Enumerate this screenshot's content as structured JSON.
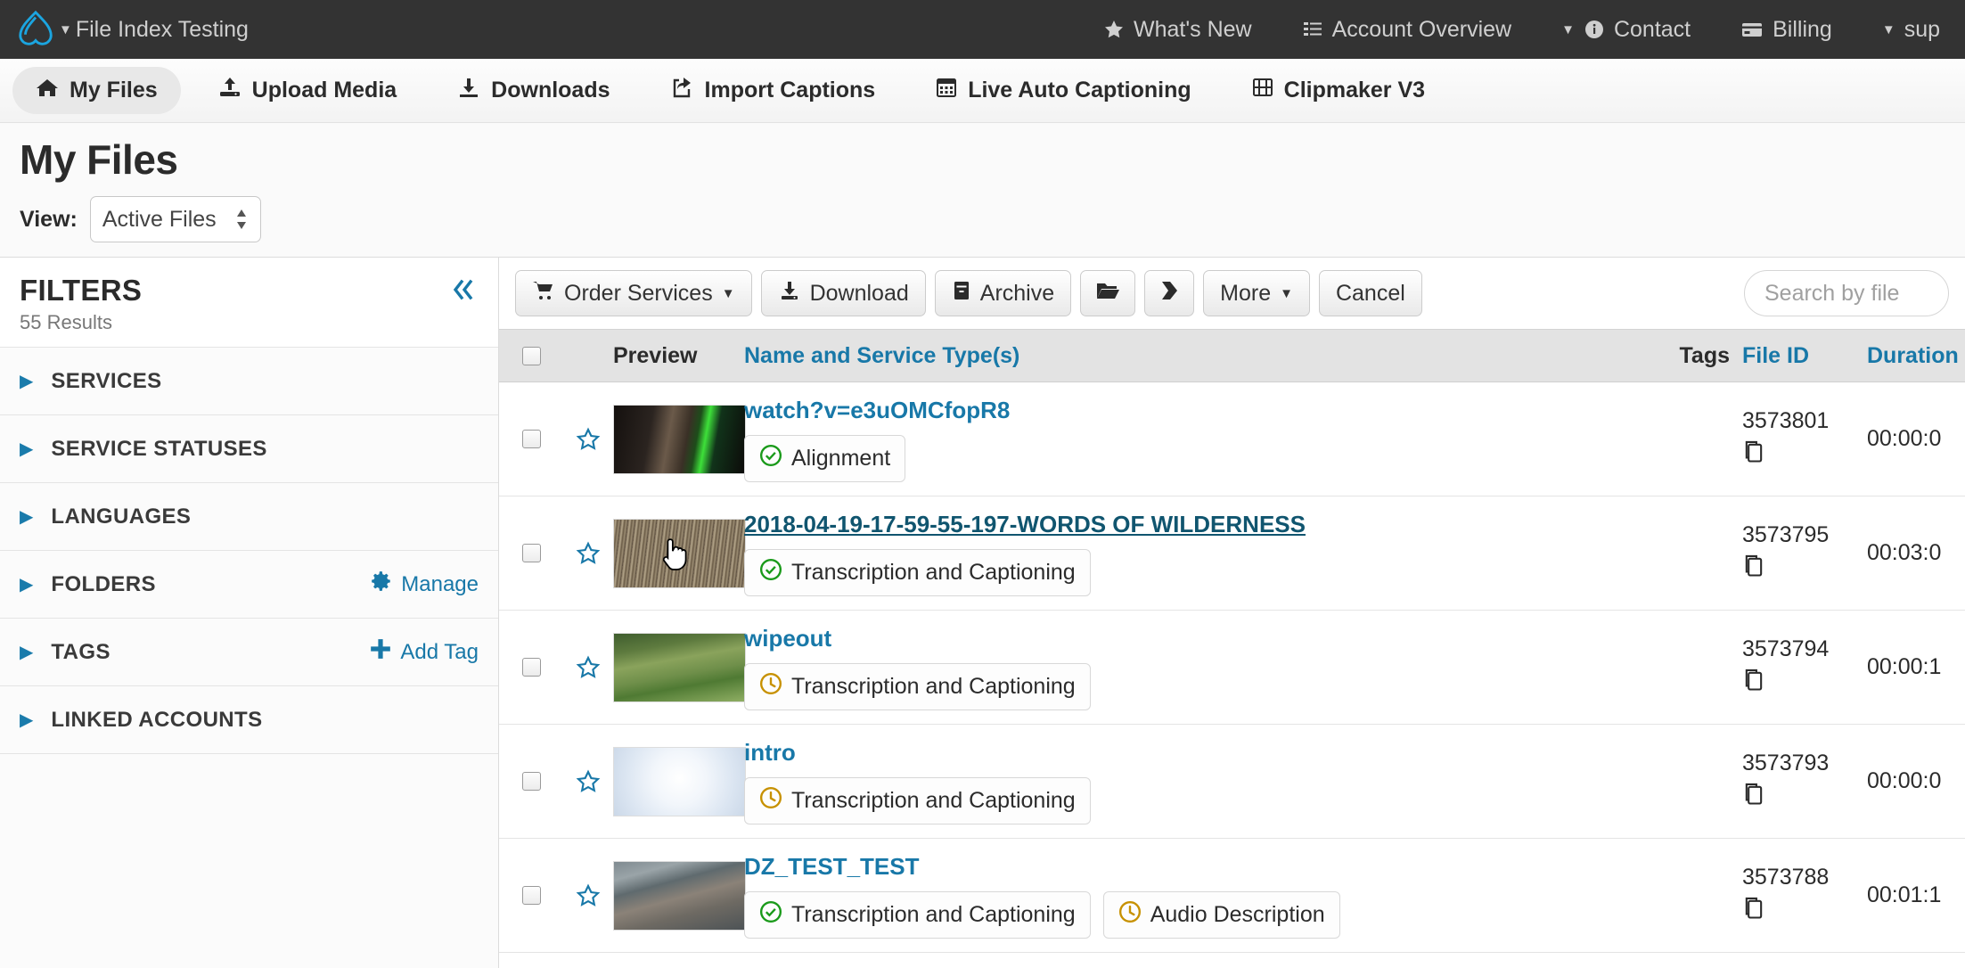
{
  "topbar": {
    "brand": "File Index Testing",
    "nav": [
      {
        "label": "What's New",
        "icon": "star-icon"
      },
      {
        "label": "Account Overview",
        "icon": "list-icon"
      },
      {
        "label": "Contact",
        "icon": "info-icon",
        "caret": true
      },
      {
        "label": "Billing",
        "icon": "card-icon"
      },
      {
        "label": "sup",
        "icon": "",
        "caret": true
      }
    ]
  },
  "mainnav": {
    "tabs": [
      {
        "label": "My Files",
        "icon": "home-icon",
        "active": true
      },
      {
        "label": "Upload Media",
        "icon": "upload-icon",
        "active": false
      },
      {
        "label": "Downloads",
        "icon": "download-icon",
        "active": false
      },
      {
        "label": "Import Captions",
        "icon": "share-icon",
        "active": false
      },
      {
        "label": "Live Auto Captioning",
        "icon": "calendar-icon",
        "active": false
      },
      {
        "label": "Clipmaker V3",
        "icon": "film-icon",
        "active": false
      }
    ]
  },
  "page": {
    "title": "My Files",
    "view_label": "View:",
    "view_value": "Active Files"
  },
  "filters": {
    "title": "FILTERS",
    "results": "55 Results",
    "collapse_icon": "double-chevron-left-icon",
    "groups": [
      {
        "label": "SERVICES",
        "action": null
      },
      {
        "label": "SERVICE STATUSES",
        "action": null
      },
      {
        "label": "LANGUAGES",
        "action": null
      },
      {
        "label": "FOLDERS",
        "action": "Manage",
        "action_icon": "gear-icon"
      },
      {
        "label": "TAGS",
        "action": "Add Tag",
        "action_icon": "plus-icon"
      },
      {
        "label": "LINKED ACCOUNTS",
        "action": null
      }
    ]
  },
  "toolbar": {
    "buttons": [
      {
        "label": "Order Services",
        "icon": "cart-icon",
        "caret": true
      },
      {
        "label": "Download",
        "icon": "download-icon",
        "caret": false
      },
      {
        "label": "Archive",
        "icon": "archive-icon",
        "caret": false
      },
      {
        "label": "",
        "icon": "folder-open-icon",
        "caret": false
      },
      {
        "label": "",
        "icon": "tag-icon",
        "caret": false
      },
      {
        "label": "More",
        "icon": "",
        "caret": true
      },
      {
        "label": "Cancel",
        "icon": "",
        "caret": false
      }
    ],
    "search_placeholder": "Search by file"
  },
  "table": {
    "headers": {
      "preview": "Preview",
      "name": "Name and Service Type(s)",
      "tags": "Tags",
      "file_id": "File ID",
      "duration": "Duration"
    },
    "rows": [
      {
        "name": "watch?v=e3uOMCfopR8",
        "hovered": false,
        "thumb": "speaker-green",
        "badges": [
          {
            "label": "Alignment",
            "status": "complete"
          }
        ],
        "file_id": "3573801",
        "duration": "00:00:0"
      },
      {
        "name": "2018-04-19-17-59-55-197-WORDS OF WILDERNESS",
        "hovered": true,
        "thumb": "grass",
        "badges": [
          {
            "label": "Transcription and Captioning",
            "status": "complete"
          }
        ],
        "file_id": "3573795",
        "duration": "00:03:0"
      },
      {
        "name": "wipeout",
        "hovered": false,
        "thumb": "field",
        "badges": [
          {
            "label": "Transcription and Captioning",
            "status": "pending"
          }
        ],
        "file_id": "3573794",
        "duration": "00:00:1"
      },
      {
        "name": "intro",
        "hovered": false,
        "thumb": "light",
        "badges": [
          {
            "label": "Transcription and Captioning",
            "status": "pending"
          }
        ],
        "file_id": "3573793",
        "duration": "00:00:0"
      },
      {
        "name": "DZ_TEST_TEST",
        "hovered": false,
        "thumb": "water",
        "badges": [
          {
            "label": "Transcription and Captioning",
            "status": "complete"
          },
          {
            "label": "Audio Description",
            "status": "pending"
          }
        ],
        "file_id": "3573788",
        "duration": "00:01:1"
      }
    ]
  },
  "colors": {
    "link": "#1878a8",
    "complete": "#1a9a1a",
    "pending": "#c79100",
    "topbar_bg": "#333333"
  }
}
